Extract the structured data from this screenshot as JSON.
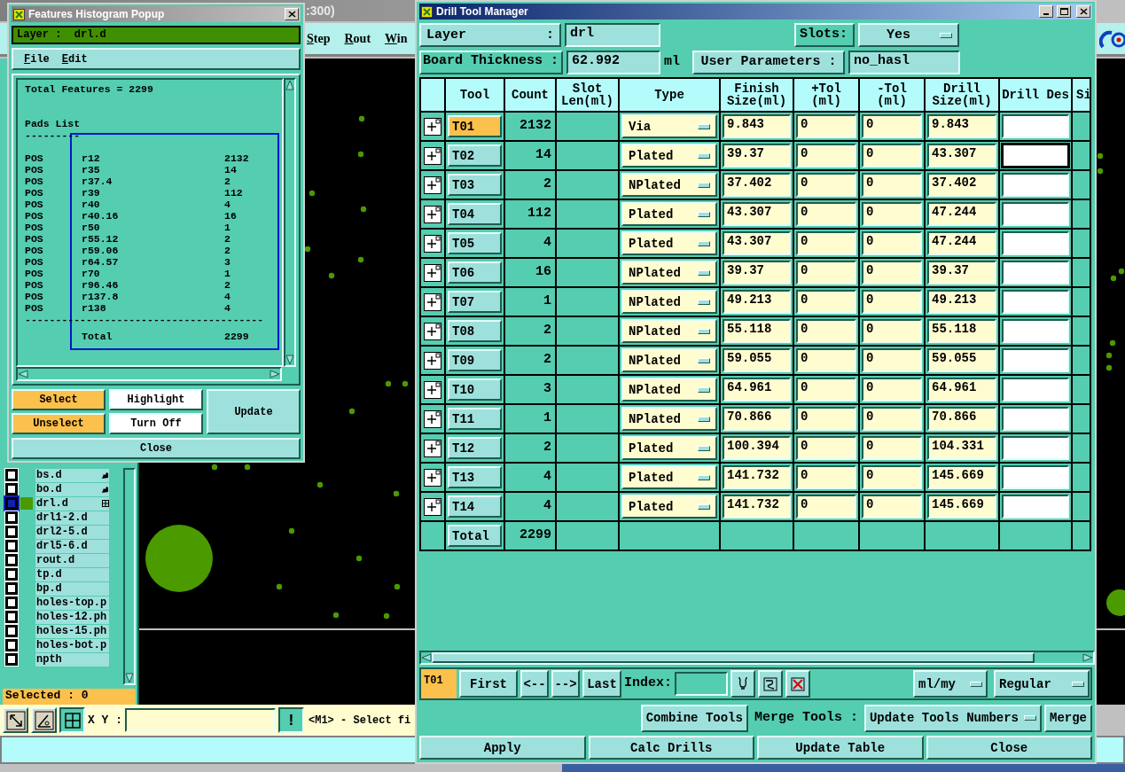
{
  "app": {
    "title": ":300)",
    "menu": [
      "Step",
      "Rout",
      "Win"
    ],
    "layers": [
      {
        "name": "bs.d",
        "selected": false,
        "kind": "hand"
      },
      {
        "name": "bo.d",
        "selected": false,
        "kind": "hand"
      },
      {
        "name": "drl.d",
        "selected": true,
        "kind": "grid"
      },
      {
        "name": "drl1-2.d",
        "selected": false,
        "kind": "plain"
      },
      {
        "name": "drl2-5.d",
        "selected": false,
        "kind": "plain"
      },
      {
        "name": "drl5-6.d",
        "selected": false,
        "kind": "plain"
      },
      {
        "name": "rout.d",
        "selected": false,
        "kind": "plain"
      },
      {
        "name": "tp.d",
        "selected": false,
        "kind": "plain"
      },
      {
        "name": "bp.d",
        "selected": false,
        "kind": "plain"
      },
      {
        "name": "holes-top.p",
        "selected": false,
        "kind": "plain"
      },
      {
        "name": "holes-12.ph",
        "selected": false,
        "kind": "plain"
      },
      {
        "name": "holes-15.ph",
        "selected": false,
        "kind": "plain"
      },
      {
        "name": "holes-bot.p",
        "selected": false,
        "kind": "plain"
      },
      {
        "name": "npth",
        "selected": false,
        "kind": "plain"
      }
    ],
    "selected_label": "Selected : 0",
    "toolbar": {
      "xy_label": "X Y :",
      "alert_button": "!",
      "message": "<M1> - Select fi"
    }
  },
  "histogram_popup": {
    "title": "Features Histogram Popup",
    "layer_label": "Layer :  drl.d",
    "menu": [
      "File",
      "Edit"
    ],
    "report": {
      "total_line": "Total Features = 2299",
      "heading": "Pads List",
      "underline": "---------",
      "rows": [
        {
          "type": "POS",
          "symbol": "r12",
          "count": "2132"
        },
        {
          "type": "POS",
          "symbol": "r35",
          "count": "14"
        },
        {
          "type": "POS",
          "symbol": "r37.4",
          "count": "2"
        },
        {
          "type": "POS",
          "symbol": "r39",
          "count": "112"
        },
        {
          "type": "POS",
          "symbol": "r40",
          "count": "4"
        },
        {
          "type": "POS",
          "symbol": "r40.16",
          "count": "16"
        },
        {
          "type": "POS",
          "symbol": "r50",
          "count": "1"
        },
        {
          "type": "POS",
          "symbol": "r55.12",
          "count": "2"
        },
        {
          "type": "POS",
          "symbol": "r59.06",
          "count": "2"
        },
        {
          "type": "POS",
          "symbol": "r64.57",
          "count": "3"
        },
        {
          "type": "POS",
          "symbol": "r70",
          "count": "1"
        },
        {
          "type": "POS",
          "symbol": "r96.46",
          "count": "2"
        },
        {
          "type": "POS",
          "symbol": "r137.8",
          "count": "4"
        },
        {
          "type": "POS",
          "symbol": "r138",
          "count": "4"
        }
      ],
      "separator": "---------------------------------------",
      "total_label": "Total",
      "total_value": "2299"
    },
    "buttons": [
      {
        "label": "Select",
        "kind": "accent"
      },
      {
        "label": "Highlight",
        "kind": "light"
      },
      {
        "label": "Unselect",
        "kind": "accent"
      },
      {
        "label": "Turn Off",
        "kind": "light"
      }
    ],
    "update_button": "Update",
    "close_button": "Close"
  },
  "drill_manager": {
    "title": "Drill Tool Manager",
    "layer_label": "Layer",
    "layer_colon": ":",
    "layer_value": "drl",
    "slots_label": "Slots:",
    "slots_value": "Yes",
    "thickness_label": "Board Thickness :",
    "thickness_value": "62.992",
    "thickness_unit": "ml",
    "user_params_button": "User Parameters :",
    "user_params_value": "no_hasl",
    "columns": [
      "Tool",
      "Count",
      "Slot Len(ml)",
      "Type",
      "Finish Size(ml)",
      "+Tol (ml)",
      "-Tol (ml)",
      "Drill Size(ml)",
      "Drill Des",
      "Si"
    ],
    "rows": [
      {
        "tool": "T01",
        "count": "2132",
        "type": "Via",
        "finish": "9.843",
        "plus_tol": "0",
        "minus_tol": "0",
        "drill_size": "9.843",
        "selected": true,
        "focused": false
      },
      {
        "tool": "T02",
        "count": "14",
        "type": "Plated",
        "finish": "39.37",
        "plus_tol": "0",
        "minus_tol": "0",
        "drill_size": "43.307",
        "selected": false,
        "focused": true
      },
      {
        "tool": "T03",
        "count": "2",
        "type": "NPlated",
        "finish": "37.402",
        "plus_tol": "0",
        "minus_tol": "0",
        "drill_size": "37.402",
        "selected": false,
        "focused": false
      },
      {
        "tool": "T04",
        "count": "112",
        "type": "Plated",
        "finish": "43.307",
        "plus_tol": "0",
        "minus_tol": "0",
        "drill_size": "47.244",
        "selected": false,
        "focused": false
      },
      {
        "tool": "T05",
        "count": "4",
        "type": "Plated",
        "finish": "43.307",
        "plus_tol": "0",
        "minus_tol": "0",
        "drill_size": "47.244",
        "selected": false,
        "focused": false
      },
      {
        "tool": "T06",
        "count": "16",
        "type": "NPlated",
        "finish": "39.37",
        "plus_tol": "0",
        "minus_tol": "0",
        "drill_size": "39.37",
        "selected": false,
        "focused": false
      },
      {
        "tool": "T07",
        "count": "1",
        "type": "NPlated",
        "finish": "49.213",
        "plus_tol": "0",
        "minus_tol": "0",
        "drill_size": "49.213",
        "selected": false,
        "focused": false
      },
      {
        "tool": "T08",
        "count": "2",
        "type": "NPlated",
        "finish": "55.118",
        "plus_tol": "0",
        "minus_tol": "0",
        "drill_size": "55.118",
        "selected": false,
        "focused": false
      },
      {
        "tool": "T09",
        "count": "2",
        "type": "NPlated",
        "finish": "59.055",
        "plus_tol": "0",
        "minus_tol": "0",
        "drill_size": "59.055",
        "selected": false,
        "focused": false
      },
      {
        "tool": "T10",
        "count": "3",
        "type": "NPlated",
        "finish": "64.961",
        "plus_tol": "0",
        "minus_tol": "0",
        "drill_size": "64.961",
        "selected": false,
        "focused": false
      },
      {
        "tool": "T11",
        "count": "1",
        "type": "NPlated",
        "finish": "70.866",
        "plus_tol": "0",
        "minus_tol": "0",
        "drill_size": "70.866",
        "selected": false,
        "focused": false
      },
      {
        "tool": "T12",
        "count": "2",
        "type": "Plated",
        "finish": "100.394",
        "plus_tol": "0",
        "minus_tol": "0",
        "drill_size": "104.331",
        "selected": false,
        "focused": false
      },
      {
        "tool": "T13",
        "count": "4",
        "type": "Plated",
        "finish": "141.732",
        "plus_tol": "0",
        "minus_tol": "0",
        "drill_size": "145.669",
        "selected": false,
        "focused": false
      },
      {
        "tool": "T14",
        "count": "4",
        "type": "Plated",
        "finish": "141.732",
        "plus_tol": "0",
        "minus_tol": "0",
        "drill_size": "145.669",
        "selected": false,
        "focused": false
      }
    ],
    "total": {
      "label": "Total",
      "count": "2299"
    },
    "nav": {
      "current": "T01",
      "buttons": [
        "First",
        "<--",
        "-->",
        "Last"
      ],
      "index_label": "Index:",
      "units": "ml/my",
      "mode": "Regular"
    },
    "merge": {
      "combine_button": "Combine Tools",
      "label": "Merge Tools :",
      "option": "Update Tools Numbers",
      "merge_button": "Merge"
    },
    "actions": [
      "Apply",
      "Calc Drills",
      "Update Table",
      "Close"
    ]
  }
}
